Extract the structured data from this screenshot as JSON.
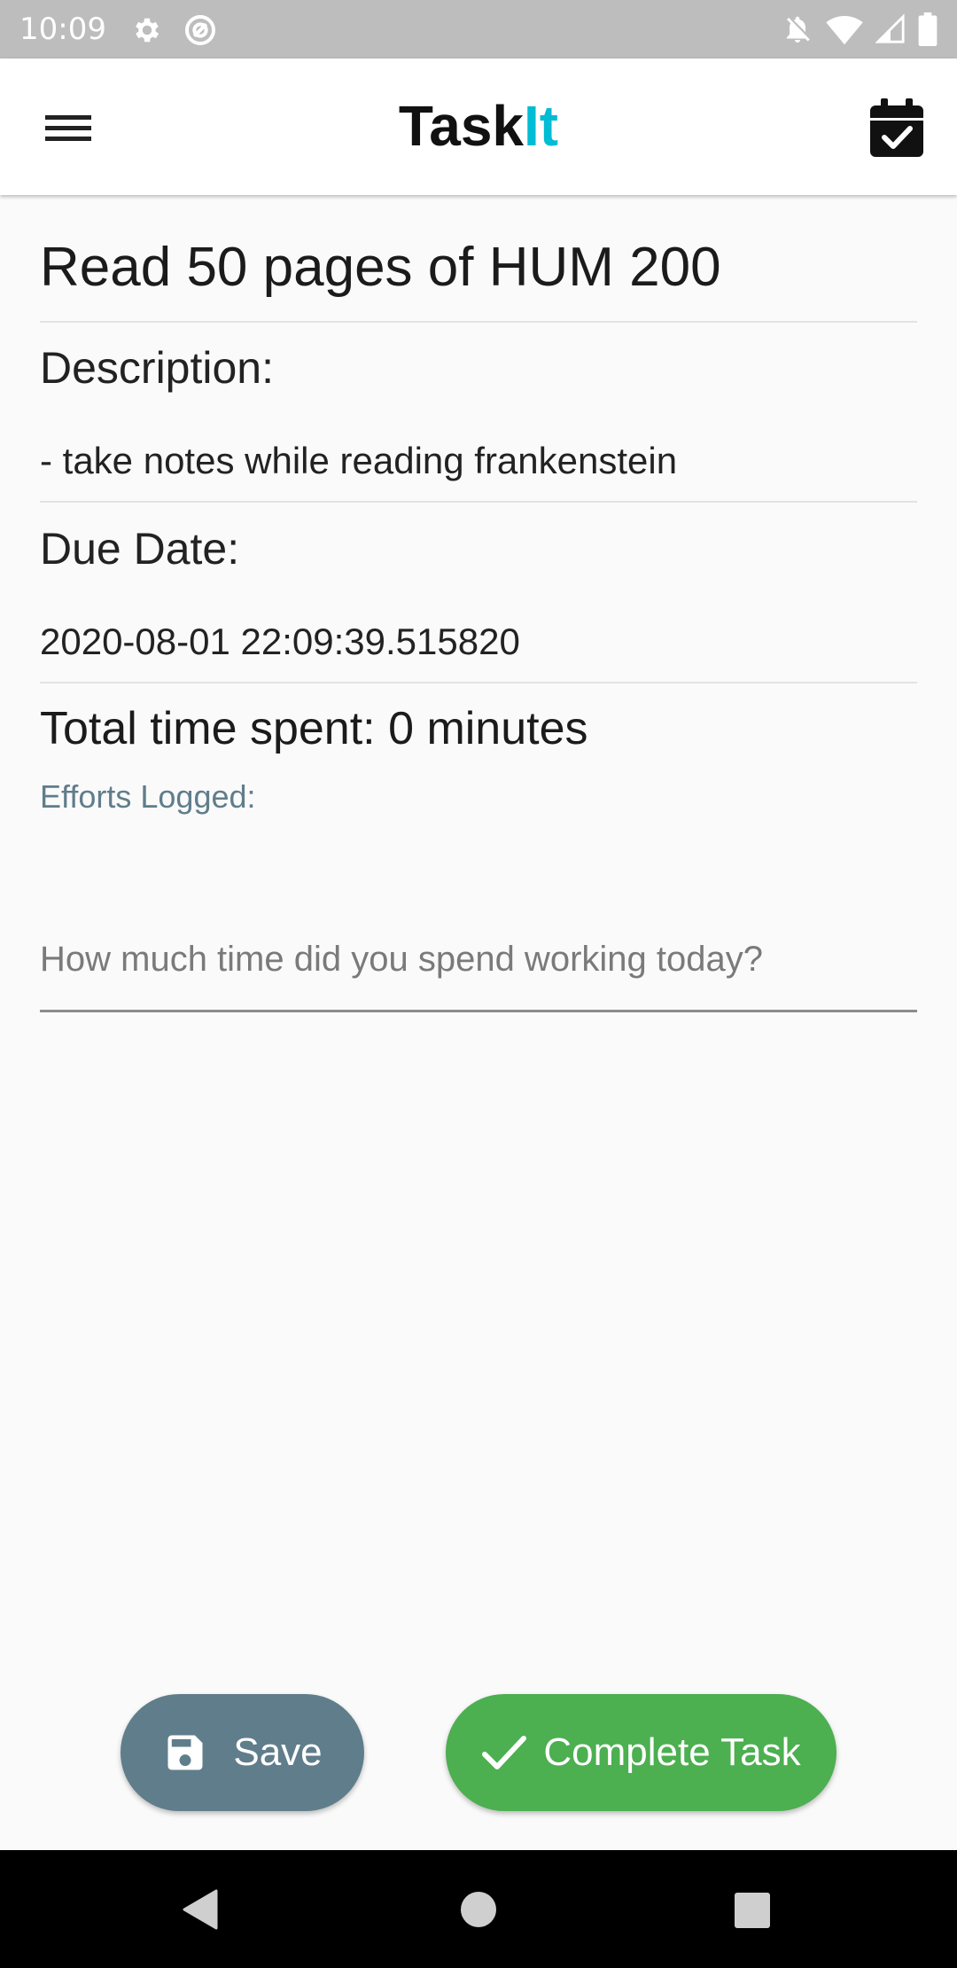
{
  "status_bar": {
    "time": "10:09",
    "left_icons": [
      "gear-icon",
      "at-sign-icon"
    ],
    "right_icons": [
      "notifications-off-icon",
      "wifi-icon",
      "signal-icon",
      "battery-icon"
    ]
  },
  "app_bar": {
    "title_main": "Task",
    "title_accent": "It",
    "accent_color": "#00bcd4",
    "menu_icon": "menu-icon",
    "calendar_icon": "calendar-check-icon"
  },
  "task": {
    "title": "Read 50 pages of HUM 200",
    "description_label": "Description:",
    "description_value": "- take notes while reading frankenstein",
    "due_date_label": "Due Date:",
    "due_date_value": "2020-08-01 22:09:39.515820",
    "total_time": "Total time spent: 0 minutes",
    "efforts_label": "Efforts Logged:"
  },
  "time_input": {
    "value": "",
    "placeholder": "How much time did you spend working today?"
  },
  "buttons": {
    "save_label": "Save",
    "save_color": "#607d8b",
    "complete_label": "Complete Task",
    "complete_color": "#4caf50"
  },
  "nav_bar": {
    "icons": [
      "back-icon",
      "home-icon",
      "recents-icon"
    ]
  }
}
